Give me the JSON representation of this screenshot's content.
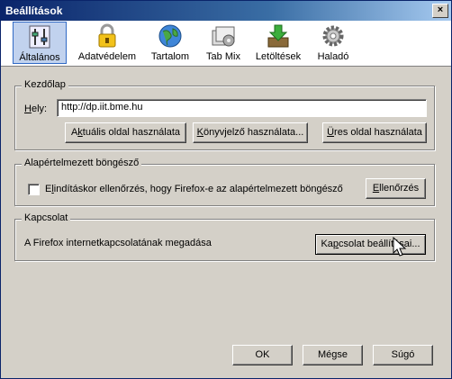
{
  "window": {
    "title": "Beállítások",
    "close_label": "×"
  },
  "tabs": [
    {
      "label": "Általános",
      "icon": "sliders-icon",
      "active": true
    },
    {
      "label": "Adatvédelem",
      "icon": "lock-icon"
    },
    {
      "label": "Tartalom",
      "icon": "globe-icon"
    },
    {
      "label": "Tab Mix",
      "icon": "tab-mix-icon"
    },
    {
      "label": "Letöltések",
      "icon": "download-icon"
    },
    {
      "label": "Haladó",
      "icon": "gear-icon"
    }
  ],
  "home": {
    "group_title": "Kezdőlap",
    "location_label": "Hely:",
    "location_value": "http://dp.iit.bme.hu",
    "btn_current": "Aktuális oldal használata",
    "btn_bookmark": "Könyvjelző használata...",
    "btn_blank": "Üres oldal használata"
  },
  "default_browser": {
    "group_title": "Alapértelmezett böngésző",
    "check_label": "Elindításkor ellenőrzés, hogy Firefox-e az alapértelmezett böngésző",
    "checked": false,
    "btn_check": "Ellenőrzés"
  },
  "connection": {
    "group_title": "Kapcsolat",
    "desc": "A Firefox internetkapcsolatának megadása",
    "btn_settings": "Kapcsolat beállításai..."
  },
  "footer": {
    "ok": "OK",
    "cancel": "Mégse",
    "help": "Súgó"
  }
}
